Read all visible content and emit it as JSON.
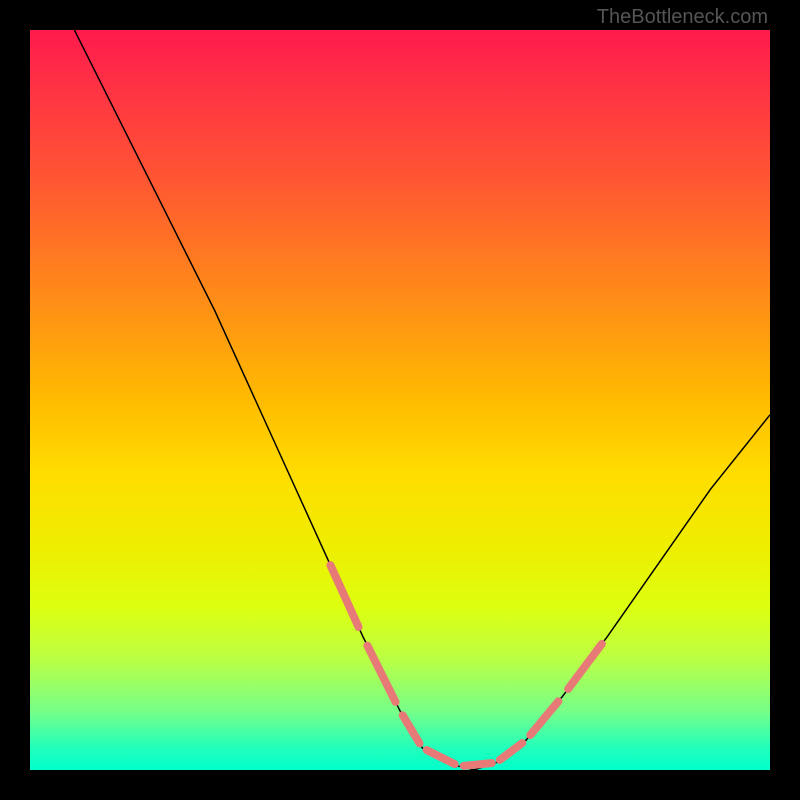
{
  "watermark": "TheBottleneck.com",
  "chart_data": {
    "type": "line",
    "title": "",
    "xlabel": "",
    "ylabel": "",
    "xlim": [
      0,
      100
    ],
    "ylim": [
      0,
      100
    ],
    "background_gradient": {
      "orientation": "vertical",
      "stops": [
        {
          "pos": 0,
          "color": "#ff1a4d"
        },
        {
          "pos": 8,
          "color": "#ff3344"
        },
        {
          "pos": 20,
          "color": "#ff5533"
        },
        {
          "pos": 30,
          "color": "#ff7722"
        },
        {
          "pos": 40,
          "color": "#ff9911"
        },
        {
          "pos": 50,
          "color": "#ffbb00"
        },
        {
          "pos": 60,
          "color": "#ffdd00"
        },
        {
          "pos": 70,
          "color": "#eeee00"
        },
        {
          "pos": 78,
          "color": "#ddff11"
        },
        {
          "pos": 85,
          "color": "#bbff44"
        },
        {
          "pos": 92,
          "color": "#77ff88"
        },
        {
          "pos": 97,
          "color": "#22ffbb"
        },
        {
          "pos": 100,
          "color": "#00ffcc"
        }
      ]
    },
    "series": [
      {
        "name": "main-curve",
        "color": "#000000",
        "x": [
          6,
          10,
          15,
          20,
          25,
          30,
          35,
          40,
          45,
          50,
          53,
          56,
          60,
          63,
          67,
          72,
          78,
          85,
          92,
          100
        ],
        "y": [
          100,
          92,
          82,
          72,
          62,
          51,
          40,
          29,
          18,
          8,
          3,
          1,
          0,
          1,
          4,
          10,
          18,
          28,
          38,
          48
        ]
      },
      {
        "name": "highlight-dashes",
        "color": "#e77a77",
        "style": "dashed-thick",
        "segments": [
          {
            "x": [
              40,
              45
            ],
            "y": [
              29,
              18
            ]
          },
          {
            "x": [
              45,
              50
            ],
            "y": [
              18,
              8
            ]
          },
          {
            "x": [
              50,
              53
            ],
            "y": [
              8,
              3
            ]
          },
          {
            "x": [
              53,
              58
            ],
            "y": [
              3,
              0.5
            ]
          },
          {
            "x": [
              58,
              63
            ],
            "y": [
              0.5,
              1
            ]
          },
          {
            "x": [
              63,
              67
            ],
            "y": [
              1,
              4
            ]
          },
          {
            "x": [
              67,
              72
            ],
            "y": [
              4,
              10
            ]
          },
          {
            "x": [
              72,
              78
            ],
            "y": [
              10,
              18
            ]
          }
        ]
      }
    ]
  }
}
